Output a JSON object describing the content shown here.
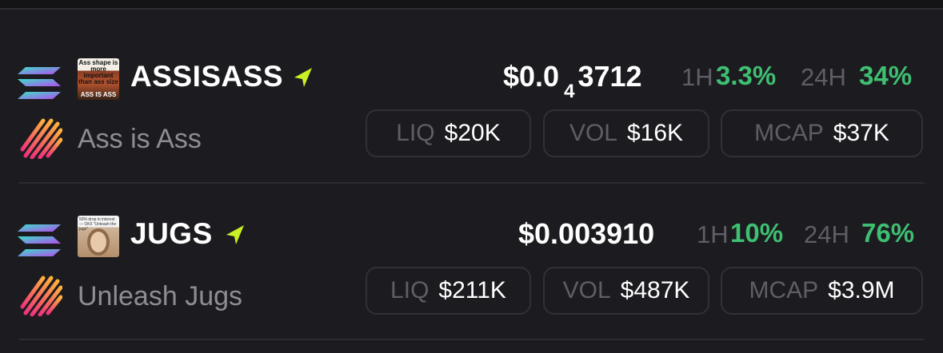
{
  "colors": {
    "background": "#1c1c20",
    "positive": "#3fbf71",
    "muted": "#5e5e66",
    "boost": "#c8f024"
  },
  "tokens": [
    {
      "chain_icon": "solana-icon",
      "dex_icon": "striped-orb-icon",
      "image_caption": "Ass shape is more important than ass size",
      "image_footer": "ASS IS ASS",
      "symbol": "ASSISASS",
      "name": "Ass is Ass",
      "price_prefix": "$0.0",
      "price_zero_count": "4",
      "price_digits": "3712",
      "h1_label": "1H",
      "h1_change": "3.3%",
      "h24_label": "24H",
      "h24_change": "34%",
      "liq_label": "LIQ",
      "liq_value": "$20K",
      "vol_label": "VOL",
      "vol_value": "$16K",
      "mcap_label": "MCAP",
      "mcap_value": "$37K"
    },
    {
      "chain_icon": "solana-icon",
      "dex_icon": "striped-orb-icon",
      "image_caption": "50% drop in interest — OK5 \"Unleash the jugs\"",
      "symbol": "JUGS",
      "name": "Unleash Jugs",
      "price": "$0.003910",
      "h1_label": "1H",
      "h1_change": "10%",
      "h24_label": "24H",
      "h24_change": "76%",
      "liq_label": "LIQ",
      "liq_value": "$211K",
      "vol_label": "VOL",
      "vol_value": "$487K",
      "mcap_label": "MCAP",
      "mcap_value": "$3.9M"
    }
  ]
}
